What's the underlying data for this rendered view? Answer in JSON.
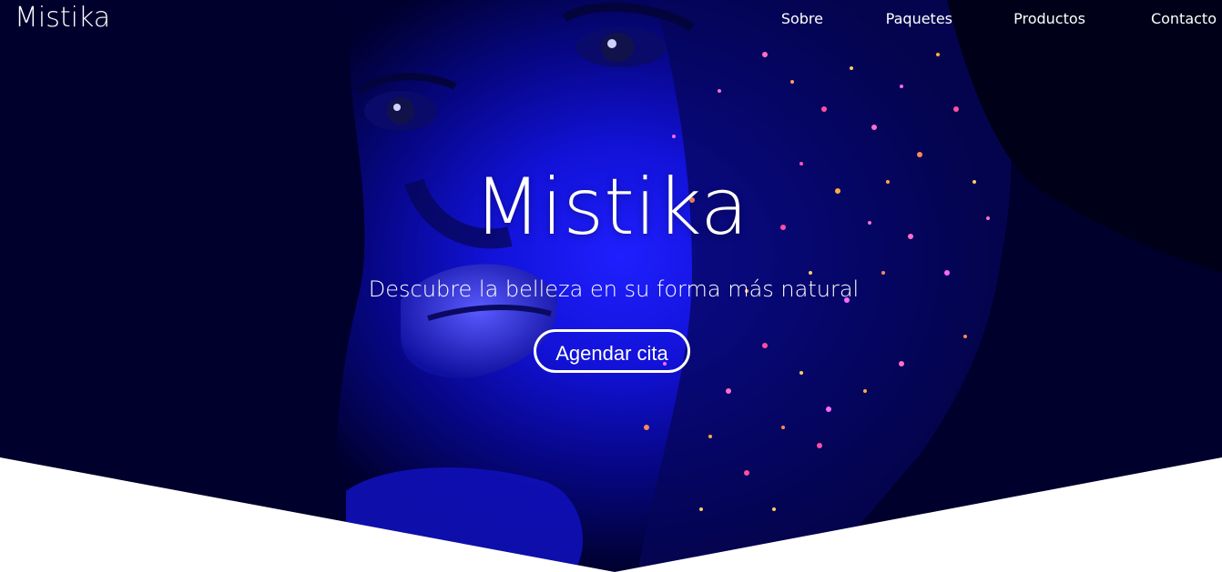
{
  "brand": {
    "name": "Mistika"
  },
  "nav": {
    "items": [
      {
        "label": "Sobre"
      },
      {
        "label": "Paquetes"
      },
      {
        "label": "Productos"
      },
      {
        "label": "Contacto"
      }
    ]
  },
  "hero": {
    "title": "Mistika",
    "subtitle": "Descubre la belleza en su forma más natural",
    "cta_label": "Agendar cita",
    "background_image": "portrait-blue-glitter-face",
    "colors": {
      "background": "#000033",
      "accent_blue": "#1a1aff",
      "text": "#ffffff",
      "section_below": "#ffffff"
    }
  }
}
